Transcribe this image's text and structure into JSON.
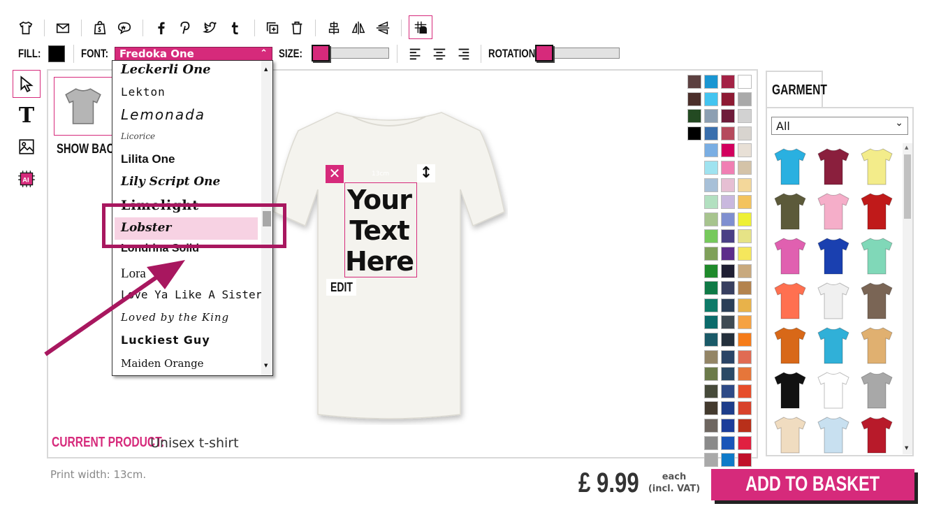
{
  "toolbar": {
    "icons": [
      "tshirt-icon",
      "email-icon",
      "shopify-icon",
      "chat-icon",
      "facebook-icon",
      "pinterest-icon",
      "twitter-icon",
      "tumblr-icon",
      "duplicate-icon",
      "trash-icon",
      "align-center-vertical-icon",
      "flip-horizontal-icon",
      "flip-vertical-icon",
      "grid-icon"
    ],
    "fill_label": "FILL:",
    "font_label": "FONT:",
    "font_value": "Fredoka One",
    "size_label": "SIZE:",
    "rotation_label": "ROTATION:",
    "fill_color": "#000000",
    "size_level": 0,
    "rotation_level": 0
  },
  "font_list": {
    "items": [
      "Leckerli One",
      "Lekton",
      "Lemonada",
      "Licorice",
      "Lilita One",
      "Lily Script One",
      "Limelight",
      "Lobster",
      "Londrina Solid",
      "Lora",
      "Love Ya Like A Sister",
      "Loved by the King",
      "Luckiest Guy",
      "Maiden Orange"
    ],
    "highlighted": "Lobster"
  },
  "side_tools": [
    "select-tool",
    "text-tool",
    "image-tool",
    "ai-tool"
  ],
  "back_view": {
    "label": "SHOW BACK"
  },
  "design": {
    "text_lines": [
      "Your",
      "Text",
      "Here"
    ],
    "size_label": "13cm",
    "edit_label": "EDIT",
    "current_product_label": "CURRENT PRODUCT:",
    "current_product_value": "Unisex t-shirt"
  },
  "swatch_colors": [
    [
      "#5c4040",
      "#1a96d2",
      "#a32245",
      "#ffffff"
    ],
    [
      "#4b2e2a",
      "#43c4f0",
      "#8d1a33",
      "#a9a9a9"
    ],
    [
      "#234a22",
      "#8c9fb2",
      "#6e1b3a",
      "#d2d2d2"
    ],
    [
      "#000000",
      "#3a6fad",
      "#b54a5d",
      "#d8d4cf"
    ],
    [
      null,
      "#7aaee3",
      "#d2005e",
      "#e8e0d6"
    ],
    [
      null,
      "#9fe3f0",
      "#f07fb3",
      "#d4c3a8"
    ],
    [
      null,
      "#a7c0d8",
      "#e6bfd3",
      "#f3d79a"
    ],
    [
      null,
      "#b2e0c0",
      "#c9b8de",
      "#f3c35e"
    ],
    [
      null,
      "#a7c48e",
      "#7f8fd0",
      "#eef036"
    ],
    [
      null,
      "#76c95c",
      "#4a3f85",
      "#e6e386"
    ],
    [
      null,
      "#7fa05a",
      "#5d2d8a",
      "#f5e75c"
    ],
    [
      null,
      "#1f8a2b",
      "#1f1f33",
      "#c8a97e"
    ],
    [
      null,
      "#0f7a46",
      "#383f5f",
      "#b3834e"
    ],
    [
      null,
      "#0d7a68",
      "#2b3f57",
      "#e8b24a"
    ],
    [
      null,
      "#0b6b6b",
      "#3e4a52",
      "#f5a243"
    ],
    [
      null,
      "#1a5a68",
      "#24303c",
      "#f57c1a"
    ],
    [
      null,
      "#938566",
      "#2a4466",
      "#e06b53"
    ],
    [
      null,
      "#6b7a4a",
      "#2b4a66",
      "#e6763a"
    ],
    [
      null,
      "#464a3a",
      "#2e4a86",
      "#e64e2b"
    ],
    [
      null,
      "#433a2e",
      "#1e3d8a",
      "#d8422b"
    ],
    [
      null,
      "#6e6660",
      "#1c3d9a",
      "#b8301a"
    ],
    [
      null,
      "#8a8a8a",
      "#1a55b8",
      "#e02040"
    ],
    [
      null,
      "#a9a9a9",
      "#0e7ac8",
      "#c0102a"
    ]
  ],
  "garment": {
    "tab_label": "GARMENT",
    "filter_value": "All",
    "thumbnails": [
      [
        "#2ab0e0",
        "#8a1f3d",
        "#f3ec8a"
      ],
      [
        "#5c5a3a",
        "#f5aec9",
        "#c01a1a"
      ],
      [
        "#e060b0",
        "#1a40b0",
        "#80d8b8"
      ],
      [
        "#ff7050",
        "#f0f0f0",
        "#7a6555"
      ],
      [
        "#d86818",
        "#30b0d8",
        "#e0b070"
      ],
      [
        "#111111",
        "#ffffff",
        "#a8a8a8"
      ],
      [
        "#f0dcc0",
        "#c8e0f0",
        "#b81a2a"
      ]
    ]
  },
  "bottom": {
    "print_width": "Print width: 13cm.",
    "price": "£ 9.99",
    "each": "each",
    "incl_vat": "(incl. VAT)",
    "add_to_basket": "ADD TO BASKET"
  }
}
